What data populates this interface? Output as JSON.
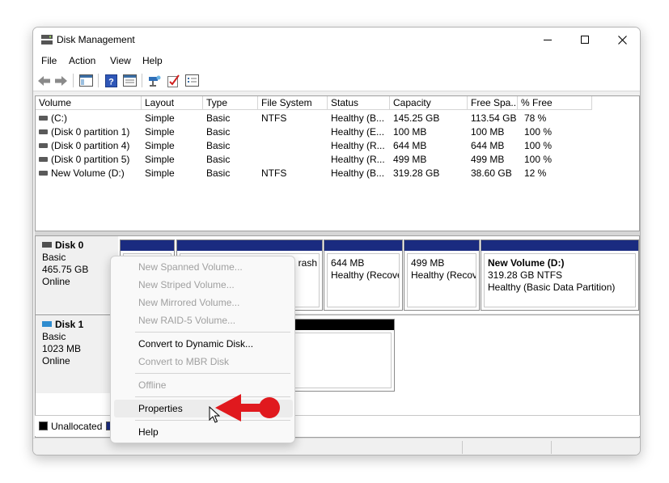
{
  "window": {
    "title": "Disk Management"
  },
  "menu": {
    "items": [
      "File",
      "Action",
      "View",
      "Help"
    ]
  },
  "toolbar": {
    "icons": [
      "back-icon",
      "forward-icon",
      "console-tree-icon",
      "help-icon",
      "properties-icon",
      "connect-icon",
      "check-icon",
      "list-icon"
    ]
  },
  "columns": [
    "Volume",
    "Layout",
    "Type",
    "File System",
    "Status",
    "Capacity",
    "Free Spa...",
    "% Free"
  ],
  "volumes": [
    {
      "volume": "(C:)",
      "layout": "Simple",
      "type": "Basic",
      "fs": "NTFS",
      "status": "Healthy (B...",
      "capacity": "145.25 GB",
      "free": "113.54 GB",
      "pct": "78 %"
    },
    {
      "volume": "(Disk 0 partition 1)",
      "layout": "Simple",
      "type": "Basic",
      "fs": "",
      "status": "Healthy (E...",
      "capacity": "100 MB",
      "free": "100 MB",
      "pct": "100 %"
    },
    {
      "volume": "(Disk 0 partition 4)",
      "layout": "Simple",
      "type": "Basic",
      "fs": "",
      "status": "Healthy (R...",
      "capacity": "644 MB",
      "free": "644 MB",
      "pct": "100 %"
    },
    {
      "volume": "(Disk 0 partition 5)",
      "layout": "Simple",
      "type": "Basic",
      "fs": "",
      "status": "Healthy (R...",
      "capacity": "499 MB",
      "free": "499 MB",
      "pct": "100 %"
    },
    {
      "volume": "New Volume (D:)",
      "layout": "Simple",
      "type": "Basic",
      "fs": "NTFS",
      "status": "Healthy (B...",
      "capacity": "319.28 GB",
      "free": "38.60 GB",
      "pct": "12 %"
    }
  ],
  "disks": [
    {
      "name": "Disk 0",
      "type": "Basic",
      "size": "465.75 GB",
      "state": "Online",
      "partitions": [
        {
          "line1": "",
          "line2": "",
          "line3": ""
        },
        {
          "line1": "",
          "line2": "",
          "line3": "rash"
        },
        {
          "line1": "",
          "line2": "644 MB",
          "line3": "Healthy (Recove"
        },
        {
          "line1": "",
          "line2": "499 MB",
          "line3": "Healthy (Recov"
        },
        {
          "line1": "New Volume  (D:)",
          "line2": "319.28 GB NTFS",
          "line3": "Healthy (Basic Data Partition)"
        }
      ]
    },
    {
      "name": "Disk 1",
      "type": "Basic",
      "size": "1023 MB",
      "state": "Online"
    }
  ],
  "legend": {
    "unallocated": "Unallocated",
    "unallocated_color": "#000000",
    "primary_color": "#1a2b80"
  },
  "context_menu": {
    "items": [
      {
        "label": "New Spanned Volume...",
        "enabled": false
      },
      {
        "label": "New Striped Volume...",
        "enabled": false
      },
      {
        "label": "New Mirrored Volume...",
        "enabled": false
      },
      {
        "label": "New RAID-5 Volume...",
        "enabled": false
      },
      {
        "label": "Convert to Dynamic Disk...",
        "enabled": true
      },
      {
        "label": "Convert to MBR Disk",
        "enabled": false
      },
      {
        "label": "Offline",
        "enabled": false
      },
      {
        "label": "Properties",
        "enabled": true,
        "highlighted": true
      },
      {
        "label": "Help",
        "enabled": true
      }
    ]
  },
  "annotation": {
    "arrow_color": "#e0191e"
  }
}
